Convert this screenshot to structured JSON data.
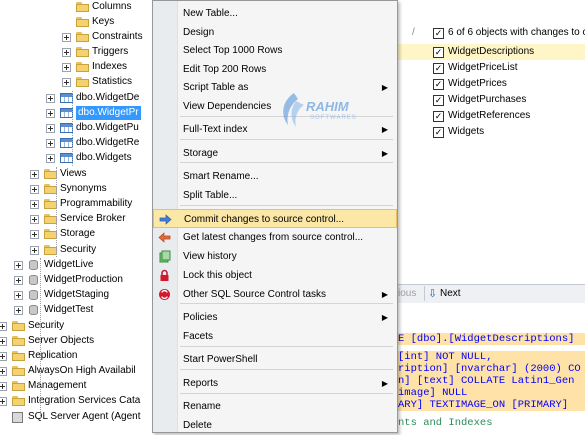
{
  "tree": {
    "items": [
      {
        "label": "Columns",
        "type": "folder"
      },
      {
        "label": "Keys",
        "type": "folder"
      },
      {
        "label": "Constraints",
        "type": "folder"
      },
      {
        "label": "Triggers",
        "type": "folder"
      },
      {
        "label": "Indexes",
        "type": "folder"
      },
      {
        "label": "Statistics",
        "type": "folder"
      },
      {
        "label": "dbo.WidgetDe",
        "type": "table"
      },
      {
        "label": "dbo.WidgetPr",
        "type": "table",
        "selected": true
      },
      {
        "label": "dbo.WidgetPu",
        "type": "table"
      },
      {
        "label": "dbo.WidgetRe",
        "type": "table"
      },
      {
        "label": "dbo.Widgets",
        "type": "table"
      },
      {
        "label": "Views",
        "type": "folder"
      },
      {
        "label": "Synonyms",
        "type": "folder"
      },
      {
        "label": "Programmability",
        "type": "folder"
      },
      {
        "label": "Service Broker",
        "type": "folder"
      },
      {
        "label": "Storage",
        "type": "folder"
      },
      {
        "label": "Security",
        "type": "folder"
      },
      {
        "label": "WidgetLive",
        "type": "db"
      },
      {
        "label": "WidgetProduction",
        "type": "db"
      },
      {
        "label": "WidgetStaging",
        "type": "db"
      },
      {
        "label": "WidgetTest",
        "type": "db"
      },
      {
        "label": "Security",
        "type": "folder"
      },
      {
        "label": "Server Objects",
        "type": "folder"
      },
      {
        "label": "Replication",
        "type": "folder"
      },
      {
        "label": "AlwaysOn High Availabil",
        "type": "folder"
      },
      {
        "label": "Management",
        "type": "folder"
      },
      {
        "label": "Integration Services Cata",
        "type": "folder"
      },
      {
        "label": "SQL Server Agent (Agent",
        "type": "agent"
      }
    ]
  },
  "menu": {
    "items": [
      {
        "label": "New Table..."
      },
      {
        "label": "Design"
      },
      {
        "label": "Select Top 1000 Rows"
      },
      {
        "label": "Edit Top 200 Rows"
      },
      {
        "label": "Script Table as",
        "submenu": true
      },
      {
        "label": "View Dependencies"
      },
      {
        "label": "Full-Text index",
        "submenu": true
      },
      {
        "label": "Storage",
        "submenu": true
      },
      {
        "label": "Smart Rename..."
      },
      {
        "label": "Split Table..."
      },
      {
        "label": "Commit changes to source control...",
        "highlighted": true,
        "icon": "commit-arrow-icon"
      },
      {
        "label": "Get latest changes from source control...",
        "icon": "get-latest-arrow-icon"
      },
      {
        "label": "View history",
        "icon": "history-icon"
      },
      {
        "label": "Lock this object",
        "icon": "lock-icon"
      },
      {
        "label": "Other SQL Source Control tasks",
        "submenu": true,
        "icon": "source-control-icon"
      },
      {
        "label": "Policies",
        "submenu": true
      },
      {
        "label": "Facets"
      },
      {
        "label": "Start PowerShell"
      },
      {
        "label": "Reports",
        "submenu": true
      },
      {
        "label": "Rename"
      },
      {
        "label": "Delete"
      }
    ]
  },
  "watermark": {
    "name": "RAHIM",
    "sub": "SOFTWARES"
  },
  "objects": {
    "summary": "6 of 6 objects with changes to co",
    "rows": [
      {
        "label": "WidgetDescriptions",
        "checked": true,
        "highlighted": true
      },
      {
        "label": "WidgetPriceList",
        "checked": true
      },
      {
        "label": "WidgetPrices",
        "checked": true
      },
      {
        "label": "WidgetPurchases",
        "checked": true
      },
      {
        "label": "WidgetReferences",
        "checked": true
      },
      {
        "label": "Widgets",
        "checked": true
      }
    ]
  },
  "nav": {
    "previous": "ious",
    "next": "Next"
  },
  "sql": {
    "lines": [
      {
        "text": "E [dbo].[WidgetDescriptions]",
        "bg": "#ffe2a8",
        "color": "#0000ff"
      },
      {
        "text": "[int] NOT NULL,",
        "bg": "#ffe2a8",
        "color": "#0000ff"
      },
      {
        "text": "ription] [nvarchar] (2000) CO",
        "bg": "#ffe2a8",
        "color": "#0000ff"
      },
      {
        "text": "n] [text] COLLATE Latin1_Gen",
        "bg": "#ffe2a8",
        "color": "#0000ff"
      },
      {
        "text": "image] NULL",
        "bg": "#ffe2a8",
        "color": "#0000ff"
      },
      {
        "text": "ARY] TEXTIMAGE_ON [PRIMARY]",
        "bg": "#ffe2a8",
        "color": "#0000ff"
      },
      {
        "text": "nts and Indexes",
        "bg": "#ffffff",
        "color": "#2e8b57"
      }
    ]
  }
}
